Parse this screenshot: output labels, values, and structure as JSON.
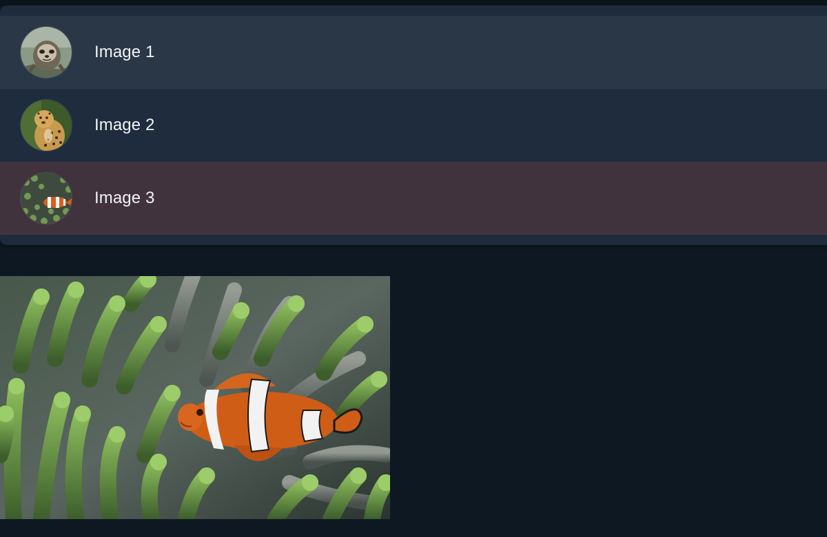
{
  "gallery": {
    "items": [
      {
        "label": "Image 1",
        "thumbnail": "sloth-photo"
      },
      {
        "label": "Image 2",
        "thumbnail": "leopard-photo"
      },
      {
        "label": "Image 3",
        "thumbnail": "clownfish-photo"
      }
    ],
    "selected_index": 2
  },
  "preview": {
    "image": "clownfish-in-anemone-photo"
  },
  "colors": {
    "page_background": "#0e1823",
    "list_background": "#1e2b3b",
    "row_hover": "#2a3746",
    "row_selected": "#41333d",
    "text": "#f2f4f6"
  }
}
